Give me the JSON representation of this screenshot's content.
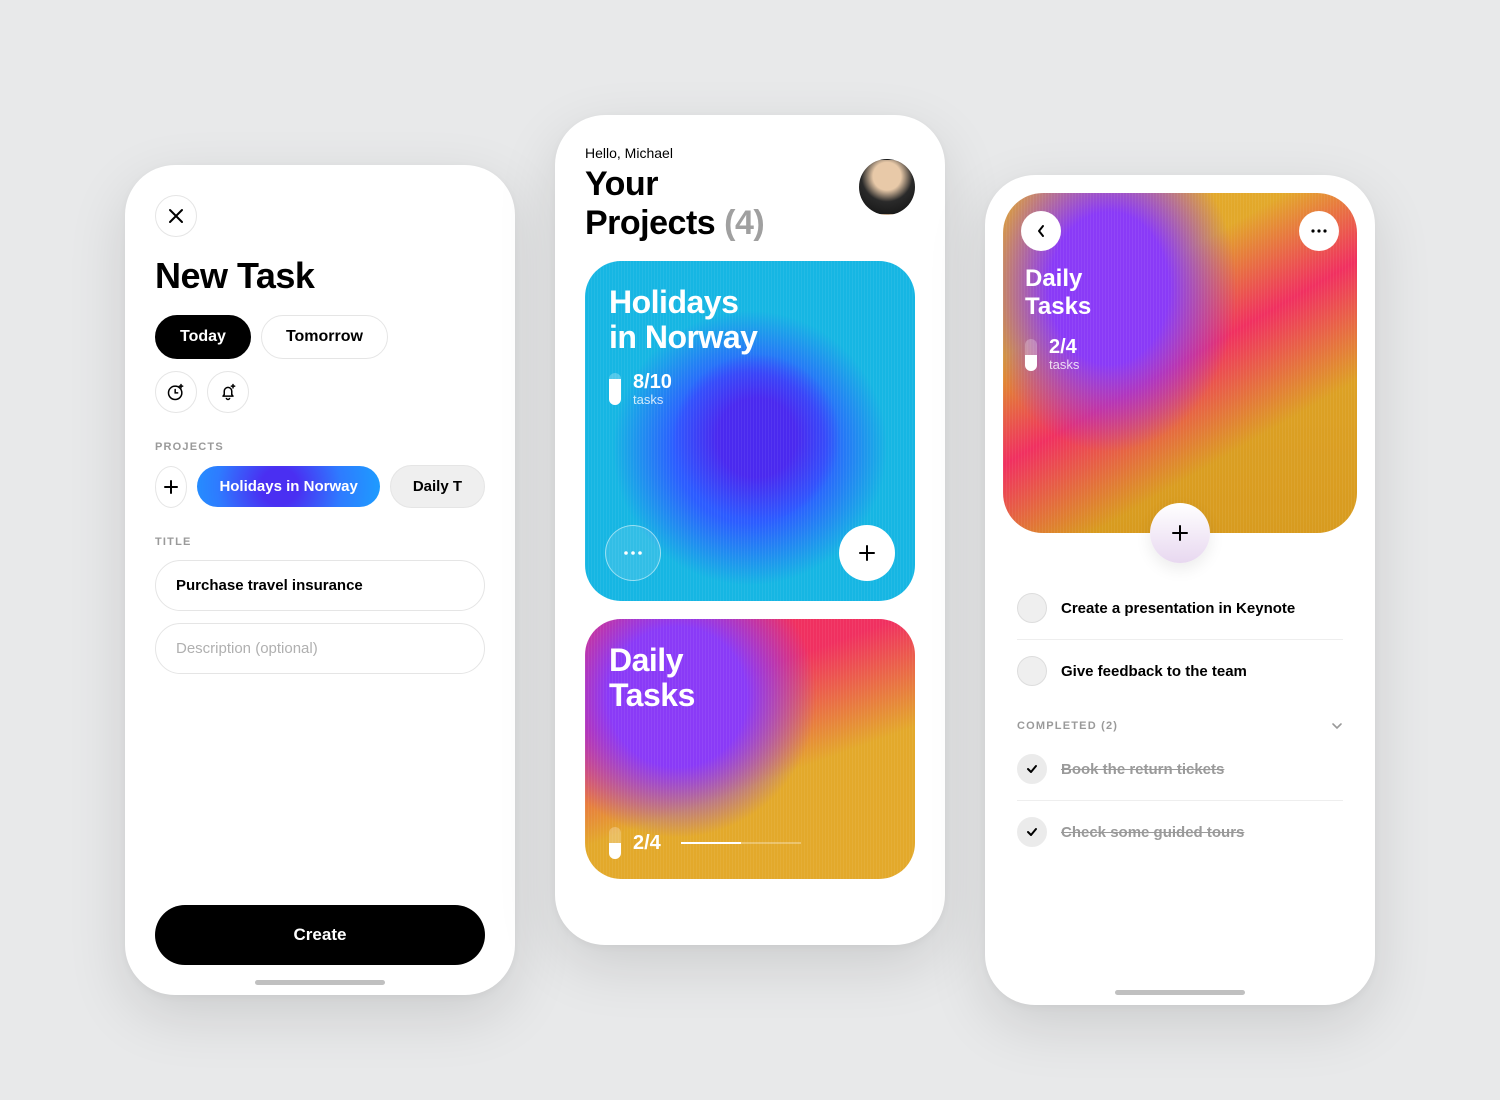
{
  "screen1": {
    "title": "New Task",
    "chips": {
      "today": "Today",
      "tomorrow": "Tomorrow"
    },
    "sectionProjects": "PROJECTS",
    "projects": {
      "selected": "Holidays in Norway",
      "other": "Daily T"
    },
    "sectionTitle": "TITLE",
    "titleValue": "Purchase travel insurance",
    "descPlaceholder": "Description (optional)",
    "create": "Create"
  },
  "screen2": {
    "greeting": "Hello, Michael",
    "titleA": "Your",
    "titleB": "Projects",
    "count": "(4)",
    "card1": {
      "title1": "Holidays",
      "title2": "in Norway",
      "count": "8/10",
      "sub": "tasks",
      "fill": 80
    },
    "card2": {
      "title1": "Daily",
      "title2": "Tasks",
      "count": "2/4",
      "fill": 50
    }
  },
  "screen3": {
    "title1": "Daily",
    "title2": "Tasks",
    "count": "2/4",
    "sub": "tasks",
    "fill": 50,
    "tasks": [
      {
        "text": "Create a presentation in Keynote",
        "done": false
      },
      {
        "text": "Give feedback to the team",
        "done": false
      }
    ],
    "completedLabel": "COMPLETED (2)",
    "completed": [
      {
        "text": "Book the return tickets"
      },
      {
        "text": "Check some guided tours"
      }
    ]
  }
}
